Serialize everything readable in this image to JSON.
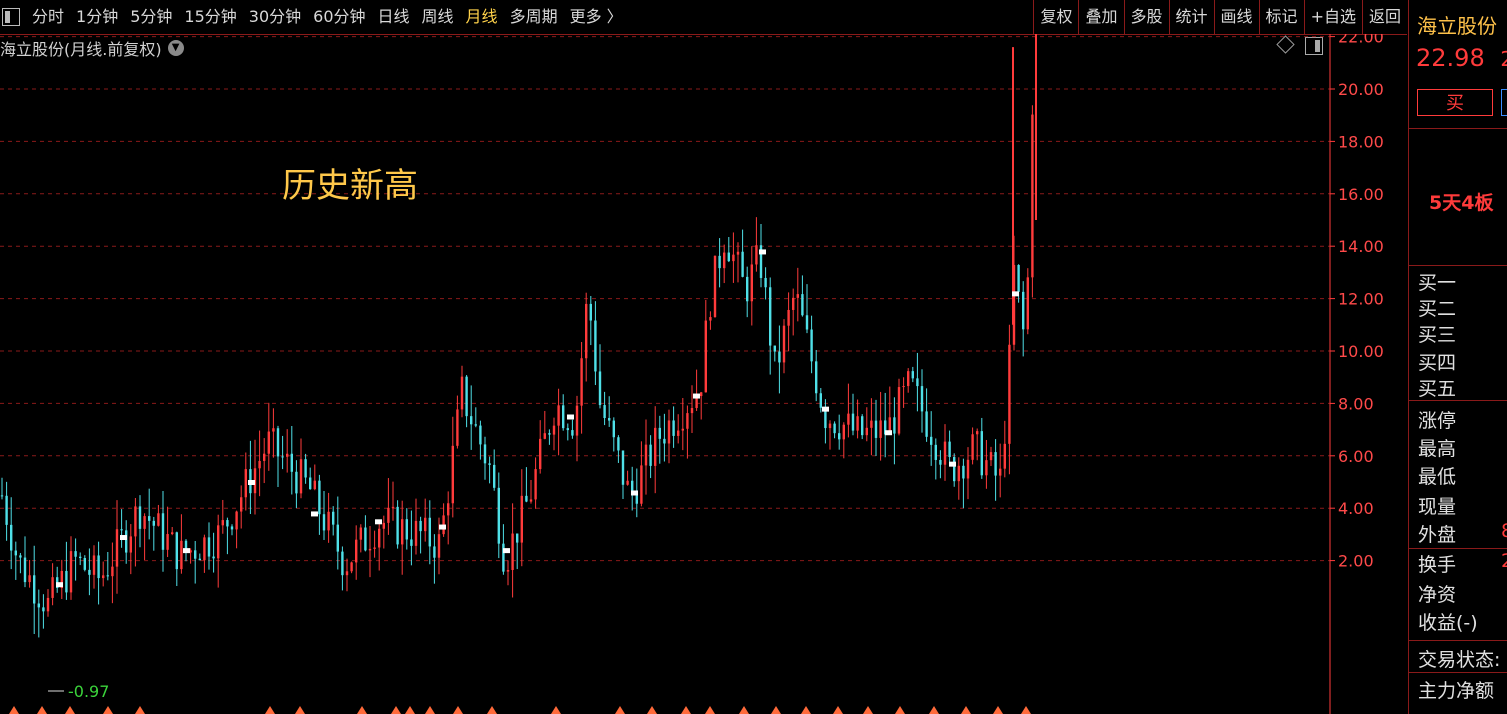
{
  "toolbar": {
    "left_tabs": [
      "分时",
      "1分钟",
      "5分钟",
      "15分钟",
      "30分钟",
      "60分钟",
      "日线",
      "周线",
      "月线",
      "多周期",
      "更多 〉"
    ],
    "active_tab": "月线",
    "right_tabs": [
      "复权",
      "叠加",
      "多股",
      "统计",
      "画线",
      "标记",
      "+自选",
      "返回"
    ]
  },
  "chart": {
    "subtitle": "海立股份(月线.前复权)",
    "annotation": "历史新高",
    "high_label": "22.98",
    "low_label": "-0.97"
  },
  "chart_data": {
    "type": "candlestick",
    "y_ticks": [
      "22.00",
      "20.00",
      "18.00",
      "16.00",
      "14.00",
      "12.00",
      "10.00",
      "8.00",
      "6.00",
      "4.00",
      "2.00"
    ],
    "ylim": [
      -0.97,
      22.98
    ],
    "max": 22.98,
    "min": -0.97
  },
  "info_panel": {
    "stock_name": "海立股份",
    "price": "22.98",
    "price_extra": "2",
    "buy_label": "买",
    "tag": "5天4板",
    "quote_rows": [
      {
        "label": "买一",
        "value": ""
      },
      {
        "label": "买二",
        "value": ""
      },
      {
        "label": "买三",
        "value": ""
      },
      {
        "label": "买四",
        "value": ""
      },
      {
        "label": "买五",
        "value": ""
      },
      {
        "label": "涨停",
        "value": ""
      },
      {
        "label": "最高",
        "value": ""
      },
      {
        "label": "最低",
        "value": ""
      },
      {
        "label": "现量",
        "value": ""
      },
      {
        "label": "外盘",
        "value": "8"
      },
      {
        "label": "换手",
        "value": "2"
      },
      {
        "label": "净资",
        "value": ""
      },
      {
        "label": "收益(-)",
        "value": ""
      },
      {
        "label": "交易状态:",
        "value": ""
      },
      {
        "label": "主力净额",
        "value": ""
      }
    ]
  },
  "colors": {
    "up": "#ff3b3b",
    "down": "#4fe0e8",
    "accent": "#ffc84a",
    "grid": "#8a1a1a",
    "high_marker": "#ff00ff"
  }
}
